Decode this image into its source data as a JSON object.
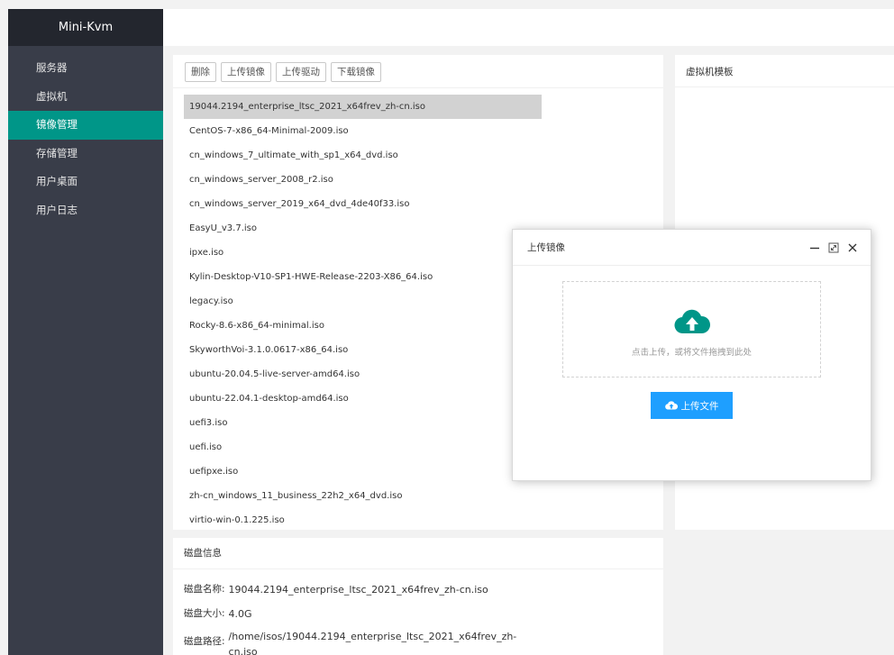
{
  "sidebar": {
    "brand": "Mini-Kvm",
    "items": [
      {
        "label": "服务器"
      },
      {
        "label": "虚拟机"
      },
      {
        "label": "镜像管理"
      },
      {
        "label": "存储管理"
      },
      {
        "label": "用户桌面"
      },
      {
        "label": "用户日志"
      }
    ]
  },
  "toolbar": {
    "delete": "删除",
    "upload_image": "上传镜像",
    "upload_driver": "上传驱动",
    "download_image": "下载镜像"
  },
  "iso_list": [
    "19044.2194_enterprise_ltsc_2021_x64frev_zh-cn.iso",
    "CentOS-7-x86_64-Minimal-2009.iso",
    "cn_windows_7_ultimate_with_sp1_x64_dvd.iso",
    "cn_windows_server_2008_r2.iso",
    "cn_windows_server_2019_x64_dvd_4de40f33.iso",
    "EasyU_v3.7.iso",
    "ipxe.iso",
    "Kylin-Desktop-V10-SP1-HWE-Release-2203-X86_64.iso",
    "legacy.iso",
    "Rocky-8.6-x86_64-minimal.iso",
    "SkyworthVoi-3.1.0.0617-x86_64.iso",
    "ubuntu-20.04.5-live-server-amd64.iso",
    "ubuntu-22.04.1-desktop-amd64.iso",
    "uefi3.iso",
    "uefi.iso",
    "uefipxe.iso",
    "zh-cn_windows_11_business_22h2_x64_dvd.iso",
    "virtio-win-0.1.225.iso"
  ],
  "template_panel": {
    "title": "虚拟机模板"
  },
  "disk_info": {
    "title": "磁盘信息",
    "name_label": "磁盘名称:",
    "name": "19044.2194_enterprise_ltsc_2021_x64frev_zh-cn.iso",
    "size_label": "磁盘大小:",
    "size": "4.0G",
    "path_label": "磁盘路径:",
    "path": "/home/isos/19044.2194_enterprise_ltsc_2021_x64frev_zh-cn.iso"
  },
  "modal": {
    "title": "上传镜像",
    "drop_text": "点击上传，或将文件拖拽到此处",
    "upload_button": "上传文件"
  },
  "colors": {
    "sidebar_bg": "#393d49",
    "brand_bg": "#23262e",
    "active_green": "#009688",
    "upload_blue": "#1e9fff",
    "selected_row": "#d2d2d2"
  },
  "icons": {
    "minimize": "minimize-icon",
    "maximize": "maximize-icon",
    "close": "close-icon",
    "cloud_upload": "cloud-upload-icon"
  }
}
